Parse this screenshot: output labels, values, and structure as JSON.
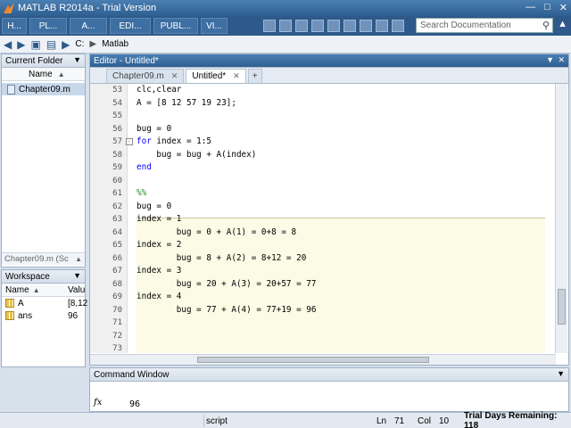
{
  "window": {
    "title": "MATLAB R2014a - Trial Version"
  },
  "ribbon": {
    "tabs": [
      "H...",
      "PL...",
      "A...",
      "EDI...",
      "PUBL...",
      "VI..."
    ],
    "search_placeholder": "Search Documentation"
  },
  "address": {
    "drive": "C:",
    "folder": "Matlab"
  },
  "current_folder": {
    "title": "Current Folder",
    "col_name": "Name",
    "files": [
      "Chapter09.m"
    ],
    "detail": "Chapter09.m (Sc"
  },
  "workspace": {
    "title": "Workspace",
    "col_name": "Name",
    "col_value": "Valu",
    "vars": [
      {
        "name": "A",
        "value": "[8,12"
      },
      {
        "name": "ans",
        "value": "96"
      }
    ]
  },
  "editor": {
    "title": "Editor - Untitled*",
    "tabs": [
      {
        "label": "Chapter09.m",
        "active": false
      },
      {
        "label": "Untitled*",
        "active": true
      }
    ],
    "add_tab": "+",
    "lines": [
      {
        "n": "53",
        "text": "clc,clear"
      },
      {
        "n": "54",
        "text": "A = [8 12 57 19 23];"
      },
      {
        "n": "55",
        "text": ""
      },
      {
        "n": "56",
        "text": "bug = 0"
      },
      {
        "n": "57",
        "kw": "for",
        "text": " index = 1:5"
      },
      {
        "n": "58",
        "text": "    bug = bug + A(index)"
      },
      {
        "n": "59",
        "kw": "end",
        "text": ""
      },
      {
        "n": "60",
        "text": ""
      },
      {
        "n": "61",
        "comment": "%%"
      },
      {
        "n": "62",
        "text": "bug = 0"
      },
      {
        "n": "63",
        "text": "index = 1"
      },
      {
        "n": "64",
        "text": "        bug = 0 + A(1) = 0+8 = 8"
      },
      {
        "n": "65",
        "text": "index = 2"
      },
      {
        "n": "66",
        "text": "        bug = 8 + A(2) = 8+12 = 20"
      },
      {
        "n": "67",
        "text": "index = 3"
      },
      {
        "n": "68",
        "text": "        bug = 20 + A(3) = 20+57 = 77"
      },
      {
        "n": "69",
        "text": "index = 4"
      },
      {
        "n": "70",
        "text": "        bug = 77 + A(4) = 77+19 = 96"
      },
      {
        "n": "71",
        "text": ""
      },
      {
        "n": "72",
        "text": ""
      },
      {
        "n": "73",
        "text": ""
      }
    ]
  },
  "command_window": {
    "title": "Command Window",
    "prompt": "fx",
    "output": "96"
  },
  "status": {
    "mode": "script",
    "ln_label": "Ln",
    "ln": "71",
    "col_label": "Col",
    "col": "10",
    "trial": "Trial Days Remaining: 118"
  }
}
